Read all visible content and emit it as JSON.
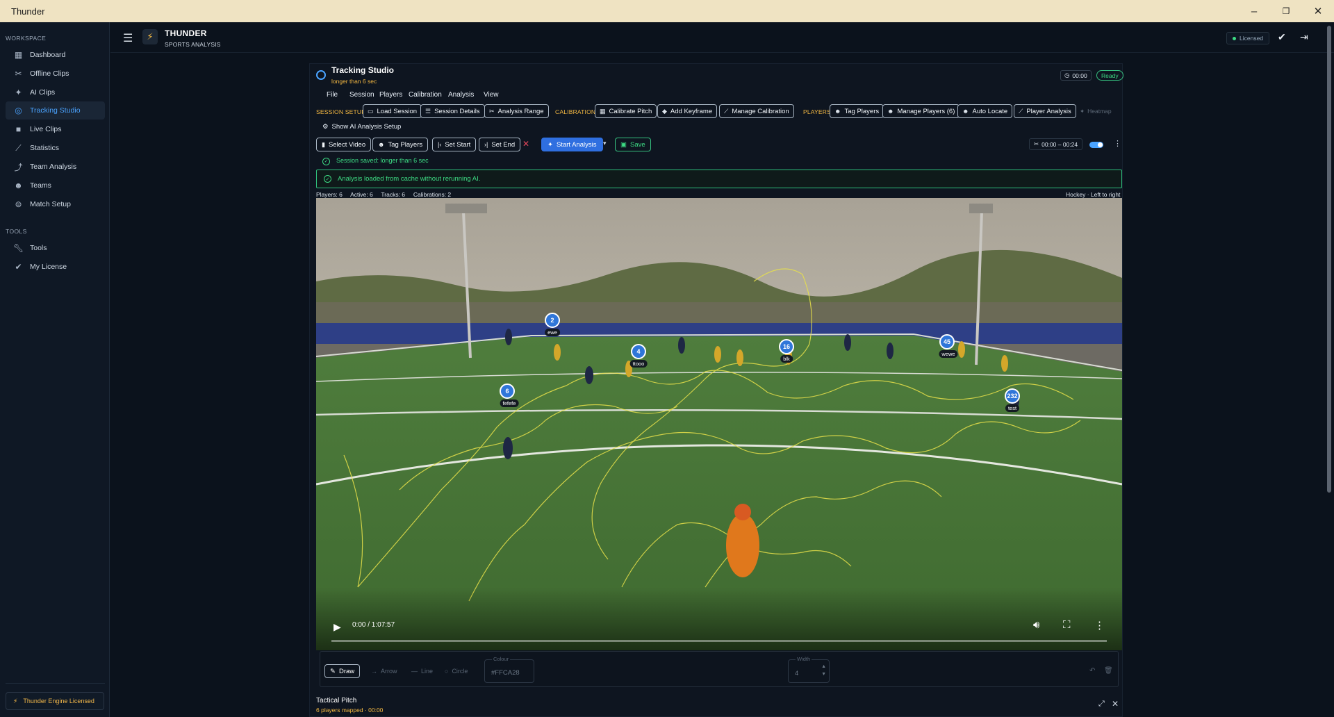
{
  "window": {
    "title": "Thunder",
    "minimize": "–",
    "maximize": "❐",
    "close": "✕"
  },
  "sidebar": {
    "workspace_label": "WORKSPACE",
    "tools_label": "TOOLS",
    "items": [
      {
        "label": "Dashboard",
        "icon": "dashboard-icon"
      },
      {
        "label": "Offline Clips",
        "icon": "scissors-icon"
      },
      {
        "label": "AI Clips",
        "icon": "sparkle-icon"
      },
      {
        "label": "Tracking Studio",
        "icon": "target-icon",
        "active": true
      },
      {
        "label": "Live Clips",
        "icon": "camera-icon"
      },
      {
        "label": "Statistics",
        "icon": "chart-icon"
      },
      {
        "label": "Team Analysis",
        "icon": "trend-icon"
      },
      {
        "label": "Teams",
        "icon": "people-icon"
      },
      {
        "label": "Match Setup",
        "icon": "whistle-icon"
      }
    ],
    "tools": [
      {
        "label": "Tools",
        "icon": "wrench-icon"
      },
      {
        "label": "My License",
        "icon": "badge-icon"
      }
    ],
    "footer": "Thunder Engine Licensed"
  },
  "header": {
    "brand": "THUNDER",
    "subtitle": "SPORTS ANALYSIS",
    "license_status": "Licensed"
  },
  "studio": {
    "title": "Tracking Studio",
    "session_name": "longer than 6 sec",
    "timer": "00:00",
    "status": "Ready",
    "menu": [
      "File",
      "Session",
      "Players",
      "Calibration",
      "Analysis",
      "View"
    ],
    "session_setup_label": "SESSION SETUP",
    "calibration_label": "CALIBRATION",
    "players_label": "PLAYERS",
    "buttons": {
      "load_session": "Load Session",
      "session_details": "Session Details",
      "analysis_range": "Analysis Range",
      "calibrate_pitch": "Calibrate Pitch",
      "add_keyframe": "Add Keyframe",
      "manage_calibration": "Manage Calibration",
      "tag_players": "Tag Players",
      "manage_players": "Manage Players (6)",
      "auto_locate": "Auto Locate",
      "player_analysis": "Player Analysis",
      "heatmap": "Heatmap"
    },
    "show_ai_setup": "Show AI Analysis Setup",
    "row2": {
      "select_video": "Select Video",
      "tag_players": "Tag Players",
      "set_start": "Set Start",
      "set_end": "Set End",
      "start_analysis": "Start Analysis",
      "save": "Save",
      "range": "00:00 – 00:24"
    },
    "saved_msg": "Session saved: longer than 6 sec",
    "cache_msg": "Analysis loaded from cache without rerunning AI.",
    "stats": "Players: 6     Active: 6     Tracks: 6     Calibrations: 2",
    "sport": "Hockey · Left to right"
  },
  "video": {
    "time": "0:00 / 1:07:57",
    "players": [
      {
        "num": "2",
        "name": "ewe"
      },
      {
        "num": "4",
        "name": "ttooo"
      },
      {
        "num": "16",
        "name": "blk"
      },
      {
        "num": "45",
        "name": "wewe"
      },
      {
        "num": "6",
        "name": "fefefe"
      },
      {
        "num": "232",
        "name": "test"
      }
    ]
  },
  "draw": {
    "draw": "Draw",
    "arrow": "Arrow",
    "line": "Line",
    "circle": "Circle",
    "colour_label": "Colour",
    "colour_value": "#FFCA28",
    "width_label": "Width",
    "width_value": "4"
  },
  "tactical": {
    "title": "Tactical Pitch",
    "subtitle": "6 players mapped · 00:00"
  }
}
